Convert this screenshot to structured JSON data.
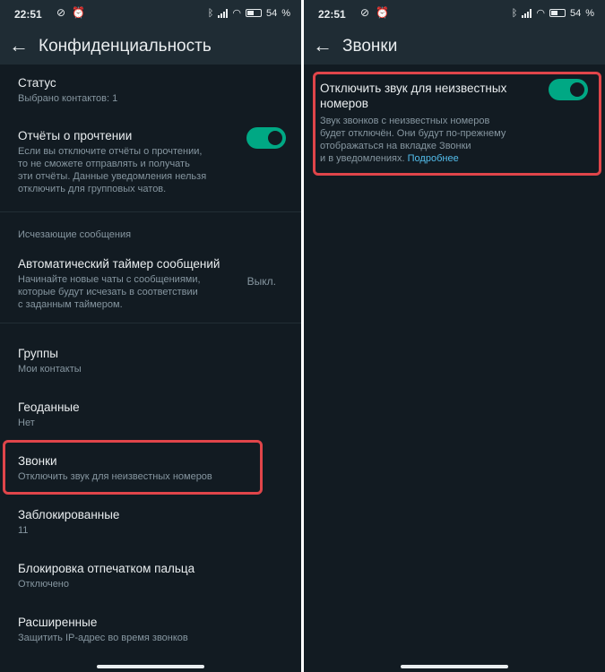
{
  "statusbar": {
    "time": "22:51",
    "icons": "⊘ ⏰",
    "battery": "54"
  },
  "left": {
    "title": "Конфиденциальность",
    "status": {
      "title": "Статус",
      "subtitle": "Выбрано контактов: 1"
    },
    "read_receipts": {
      "title": "Отчёты о прочтении",
      "lines": [
        "Если вы отключите отчёты о прочтении,",
        "то не сможете отправлять и получать",
        "эти отчёты. Данные уведомления нельзя",
        "отключить для групповых чатов."
      ],
      "enabled": true
    },
    "disappearing_header": "Исчезающие сообщения",
    "auto_timer": {
      "title": "Автоматический таймер сообщений",
      "lines": [
        "Начинайте новые чаты с сообщениями,",
        "которые будут исчезать в соответствии",
        "с заданным таймером."
      ],
      "value": "Выкл."
    },
    "groups": {
      "title": "Группы",
      "subtitle": "Мои контакты"
    },
    "location": {
      "title": "Геоданные",
      "subtitle": "Нет"
    },
    "calls": {
      "title": "Звонки",
      "subtitle": "Отключить звук для неизвестных номеров"
    },
    "blocked": {
      "title": "Заблокированные",
      "subtitle": "11"
    },
    "fingerprint": {
      "title": "Блокировка отпечатком пальца",
      "subtitle": "Отключено"
    },
    "advanced": {
      "title": "Расширенные",
      "subtitle": "Защитить IP-адрес во время звонков"
    }
  },
  "right": {
    "title": "Звонки",
    "silence": {
      "title_lines": [
        "Отключить звук для неизвестных",
        "номеров"
      ],
      "desc_lines": [
        "Звук звонков с неизвестных номеров",
        "будет отключён. Они будут по-прежнему",
        "отображаться на вкладке Звонки"
      ],
      "desc_last": "и в уведомлениях.",
      "link": "Подробнее",
      "enabled": true
    }
  },
  "colors": {
    "background": "#121b22",
    "appbar": "#1f2c34",
    "accent": "#00a884",
    "link": "#53bdeb",
    "highlight": "#e0454a"
  },
  "icons": {
    "back": "arrow-left-icon",
    "bluetooth": "bluetooth-icon",
    "signal": "signal-icon",
    "wifi": "wifi-icon",
    "battery": "battery-icon"
  }
}
